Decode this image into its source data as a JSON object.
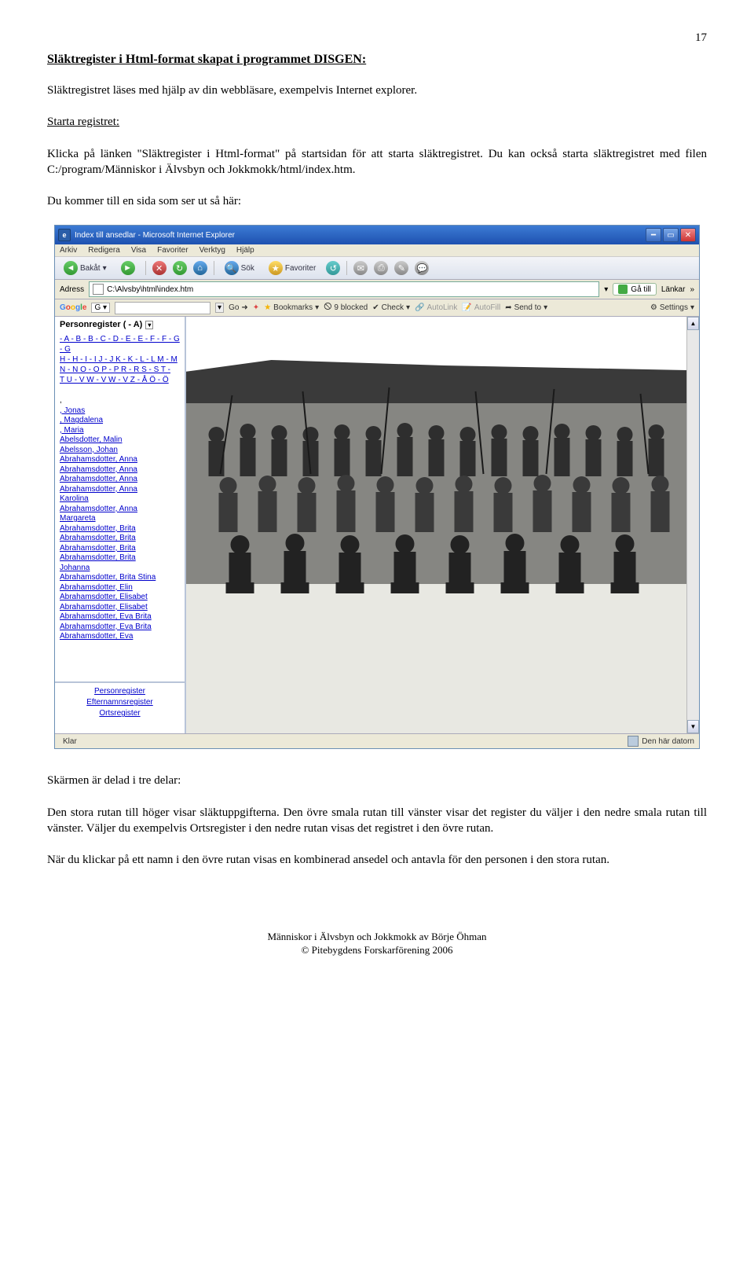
{
  "page_number": "17",
  "section_title": "Släktregister i Html-format skapat i programmet DISGEN:",
  "para1": "Släktregistret läses med hjälp av din webbläsare, exempelvis Internet explorer.",
  "starta_label": "Starta registret:",
  "para2": "Klicka på länken \"Släktregister i Html-format\" på startsidan för att starta släktregistret. Du kan också starta släktregistret med filen C:/program/Människor i Älvsbyn och Jokkmokk/html/index.htm.",
  "para3": "Du kommer till en sida som ser ut så här:",
  "after_para1": "Skärmen är delad i tre delar:",
  "after_para2": "Den stora rutan till höger visar släktuppgifterna. Den övre smala rutan till vänster visar det register du väljer i den nedre smala rutan till vänster. Väljer du exempelvis Ortsregister i den nedre rutan visas det registret i den övre rutan.",
  "after_para3": "När du klickar på ett namn i den övre rutan visas en kombinerad ansedel och antavla för den personen i den stora rutan.",
  "footer_line1": "Människor i Älvsbyn och Jokkmokk av Börje Öhman",
  "footer_line2": "© Pitebygdens Forskarförening 2006",
  "browser": {
    "window_title": "Index till ansedlar - Microsoft Internet Explorer",
    "menu": [
      "Arkiv",
      "Redigera",
      "Visa",
      "Favoriter",
      "Verktyg",
      "Hjälp"
    ],
    "back_label": "Bakåt",
    "search_label": "Sök",
    "fav_label": "Favoriter",
    "addr_label": "Adress",
    "addr_value": "C:\\Alvsby\\html\\index.htm",
    "go_label": "Gå till",
    "links_label": "Länkar",
    "google_go": "Go",
    "bookmarks_label": "Bookmarks",
    "blocked_label": "9 blocked",
    "check_label": "Check",
    "autolink_label": "AutoLink",
    "autofill_label": "AutoFill",
    "sendto_label": "Send to",
    "settings_label": "Settings",
    "register_title": "Personregister ( - A)",
    "alpha_line1": "- A - B - B - C - D - E - E - F - F - G - G",
    "alpha_line2": "H - H - I - I J - J K - K - L - L M - M",
    "alpha_line3": "N - N O - O P - P R - R S - S T -",
    "alpha_line4": "T U - V W - V W - V Z - Å Ö - Ö",
    "names": [
      ",",
      ", Jonas",
      ", Magdalena",
      ", Maria",
      "Abelsdotter, Malin",
      "Abelsson, Johan",
      "Abrahamsdotter, Anna",
      "Abrahamsdotter, Anna",
      "Abrahamsdotter, Anna",
      "Abrahamsdotter, Anna",
      "Karolina",
      "Abrahamsdotter, Anna",
      "Margareta",
      "Abrahamsdotter, Brita",
      "Abrahamsdotter, Brita",
      "Abrahamsdotter, Brita",
      "Abrahamsdotter, Brita",
      "Johanna",
      "Abrahamsdotter, Brita Stina",
      "Abrahamsdotter, Elin",
      "Abrahamsdotter, Elisabet",
      "Abrahamsdotter, Elisabet",
      "Abrahamsdotter, Eva Brita",
      "Abrahamsdotter, Eva Brita",
      "Abrahamsdotter, Eva"
    ],
    "bottom_links": [
      "Personregister",
      "Efternamnsregister",
      "Ortsregister"
    ],
    "status_left": "Klar",
    "status_right": "Den här datorn"
  }
}
